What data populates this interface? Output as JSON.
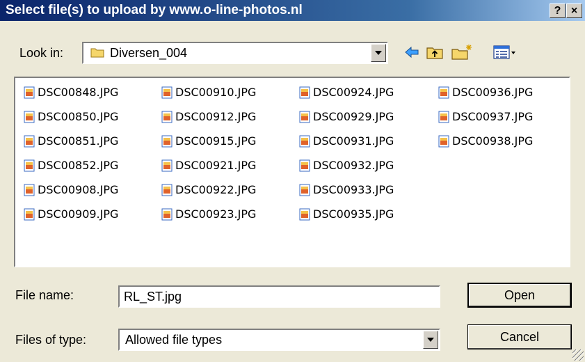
{
  "window": {
    "title": "Select file(s) to upload by www.o-line-photos.nl",
    "help_label": "?",
    "close_label": "×"
  },
  "lookin": {
    "label": "Look in:",
    "folder": "Diversen_004"
  },
  "files": [
    "DSC00848.JPG",
    "DSC00850.JPG",
    "DSC00851.JPG",
    "DSC00852.JPG",
    "DSC00908.JPG",
    "DSC00909.JPG",
    "DSC00910.JPG",
    "DSC00912.JPG",
    "DSC00915.JPG",
    "DSC00921.JPG",
    "DSC00922.JPG",
    "DSC00923.JPG",
    "DSC00924.JPG",
    "DSC00929.JPG",
    "DSC00931.JPG",
    "DSC00932.JPG",
    "DSC00933.JPG",
    "DSC00935.JPG",
    "DSC00936.JPG",
    "DSC00937.JPG",
    "DSC00938.JPG"
  ],
  "filename": {
    "label": "File name:",
    "value": "RL_ST.jpg"
  },
  "filetype": {
    "label": "Files of type:",
    "value": "Allowed file types"
  },
  "buttons": {
    "open": "Open",
    "cancel": "Cancel"
  },
  "icons": {
    "back": "back-arrow-icon",
    "up": "up-folder-icon",
    "newfolder": "new-folder-icon",
    "view": "view-menu-icon"
  }
}
